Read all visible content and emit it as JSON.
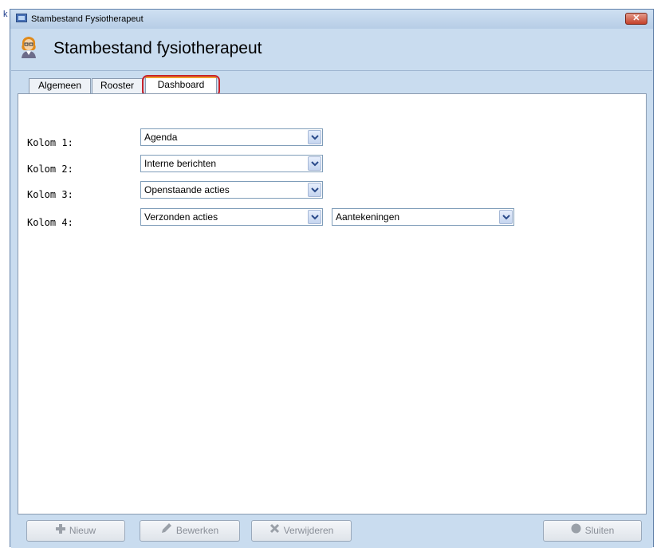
{
  "background": {
    "left_char": "k"
  },
  "window": {
    "title": "Stambestand Fysiotherapeut",
    "close_label": "✕"
  },
  "header": {
    "title": "Stambestand fysiotherapeut",
    "avatar_icon": "person-avatar-icon"
  },
  "tabs": [
    {
      "label": "Algemeen",
      "active": false
    },
    {
      "label": "Rooster",
      "active": false
    },
    {
      "label": "Dashboard",
      "active": true
    }
  ],
  "form": {
    "rows": [
      {
        "label": "Kolom 1:",
        "value": "Agenda"
      },
      {
        "label": "Kolom 2:",
        "value": "Interne berichten"
      },
      {
        "label": "Kolom 3:",
        "value": "Openstaande acties"
      },
      {
        "label": "Kolom 4:",
        "value": "Verzonden acties",
        "value2": "Aantekeningen"
      }
    ]
  },
  "footer": {
    "new_label": "Nieuw",
    "edit_label": "Bewerken",
    "delete_label": "Verwijderen",
    "close_label": "Sluiten"
  },
  "colors": {
    "window_bg": "#c9dcef",
    "tab_highlight": "#c8232c",
    "active_tab_accent": "#f0a030"
  }
}
